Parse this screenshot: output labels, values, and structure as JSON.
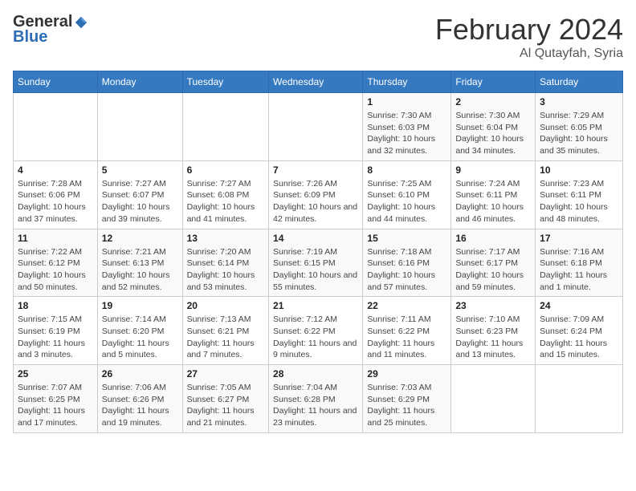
{
  "logo": {
    "general": "General",
    "blue": "Blue"
  },
  "title": "February 2024",
  "location": "Al Qutayfah, Syria",
  "days_of_week": [
    "Sunday",
    "Monday",
    "Tuesday",
    "Wednesday",
    "Thursday",
    "Friday",
    "Saturday"
  ],
  "weeks": [
    [
      {
        "day": "",
        "info": ""
      },
      {
        "day": "",
        "info": ""
      },
      {
        "day": "",
        "info": ""
      },
      {
        "day": "",
        "info": ""
      },
      {
        "day": "1",
        "sunrise": "Sunrise: 7:30 AM",
        "sunset": "Sunset: 6:03 PM",
        "daylight": "Daylight: 10 hours and 32 minutes."
      },
      {
        "day": "2",
        "sunrise": "Sunrise: 7:30 AM",
        "sunset": "Sunset: 6:04 PM",
        "daylight": "Daylight: 10 hours and 34 minutes."
      },
      {
        "day": "3",
        "sunrise": "Sunrise: 7:29 AM",
        "sunset": "Sunset: 6:05 PM",
        "daylight": "Daylight: 10 hours and 35 minutes."
      }
    ],
    [
      {
        "day": "4",
        "sunrise": "Sunrise: 7:28 AM",
        "sunset": "Sunset: 6:06 PM",
        "daylight": "Daylight: 10 hours and 37 minutes."
      },
      {
        "day": "5",
        "sunrise": "Sunrise: 7:27 AM",
        "sunset": "Sunset: 6:07 PM",
        "daylight": "Daylight: 10 hours and 39 minutes."
      },
      {
        "day": "6",
        "sunrise": "Sunrise: 7:27 AM",
        "sunset": "Sunset: 6:08 PM",
        "daylight": "Daylight: 10 hours and 41 minutes."
      },
      {
        "day": "7",
        "sunrise": "Sunrise: 7:26 AM",
        "sunset": "Sunset: 6:09 PM",
        "daylight": "Daylight: 10 hours and 42 minutes."
      },
      {
        "day": "8",
        "sunrise": "Sunrise: 7:25 AM",
        "sunset": "Sunset: 6:10 PM",
        "daylight": "Daylight: 10 hours and 44 minutes."
      },
      {
        "day": "9",
        "sunrise": "Sunrise: 7:24 AM",
        "sunset": "Sunset: 6:11 PM",
        "daylight": "Daylight: 10 hours and 46 minutes."
      },
      {
        "day": "10",
        "sunrise": "Sunrise: 7:23 AM",
        "sunset": "Sunset: 6:11 PM",
        "daylight": "Daylight: 10 hours and 48 minutes."
      }
    ],
    [
      {
        "day": "11",
        "sunrise": "Sunrise: 7:22 AM",
        "sunset": "Sunset: 6:12 PM",
        "daylight": "Daylight: 10 hours and 50 minutes."
      },
      {
        "day": "12",
        "sunrise": "Sunrise: 7:21 AM",
        "sunset": "Sunset: 6:13 PM",
        "daylight": "Daylight: 10 hours and 52 minutes."
      },
      {
        "day": "13",
        "sunrise": "Sunrise: 7:20 AM",
        "sunset": "Sunset: 6:14 PM",
        "daylight": "Daylight: 10 hours and 53 minutes."
      },
      {
        "day": "14",
        "sunrise": "Sunrise: 7:19 AM",
        "sunset": "Sunset: 6:15 PM",
        "daylight": "Daylight: 10 hours and 55 minutes."
      },
      {
        "day": "15",
        "sunrise": "Sunrise: 7:18 AM",
        "sunset": "Sunset: 6:16 PM",
        "daylight": "Daylight: 10 hours and 57 minutes."
      },
      {
        "day": "16",
        "sunrise": "Sunrise: 7:17 AM",
        "sunset": "Sunset: 6:17 PM",
        "daylight": "Daylight: 10 hours and 59 minutes."
      },
      {
        "day": "17",
        "sunrise": "Sunrise: 7:16 AM",
        "sunset": "Sunset: 6:18 PM",
        "daylight": "Daylight: 11 hours and 1 minute."
      }
    ],
    [
      {
        "day": "18",
        "sunrise": "Sunrise: 7:15 AM",
        "sunset": "Sunset: 6:19 PM",
        "daylight": "Daylight: 11 hours and 3 minutes."
      },
      {
        "day": "19",
        "sunrise": "Sunrise: 7:14 AM",
        "sunset": "Sunset: 6:20 PM",
        "daylight": "Daylight: 11 hours and 5 minutes."
      },
      {
        "day": "20",
        "sunrise": "Sunrise: 7:13 AM",
        "sunset": "Sunset: 6:21 PM",
        "daylight": "Daylight: 11 hours and 7 minutes."
      },
      {
        "day": "21",
        "sunrise": "Sunrise: 7:12 AM",
        "sunset": "Sunset: 6:22 PM",
        "daylight": "Daylight: 11 hours and 9 minutes."
      },
      {
        "day": "22",
        "sunrise": "Sunrise: 7:11 AM",
        "sunset": "Sunset: 6:22 PM",
        "daylight": "Daylight: 11 hours and 11 minutes."
      },
      {
        "day": "23",
        "sunrise": "Sunrise: 7:10 AM",
        "sunset": "Sunset: 6:23 PM",
        "daylight": "Daylight: 11 hours and 13 minutes."
      },
      {
        "day": "24",
        "sunrise": "Sunrise: 7:09 AM",
        "sunset": "Sunset: 6:24 PM",
        "daylight": "Daylight: 11 hours and 15 minutes."
      }
    ],
    [
      {
        "day": "25",
        "sunrise": "Sunrise: 7:07 AM",
        "sunset": "Sunset: 6:25 PM",
        "daylight": "Daylight: 11 hours and 17 minutes."
      },
      {
        "day": "26",
        "sunrise": "Sunrise: 7:06 AM",
        "sunset": "Sunset: 6:26 PM",
        "daylight": "Daylight: 11 hours and 19 minutes."
      },
      {
        "day": "27",
        "sunrise": "Sunrise: 7:05 AM",
        "sunset": "Sunset: 6:27 PM",
        "daylight": "Daylight: 11 hours and 21 minutes."
      },
      {
        "day": "28",
        "sunrise": "Sunrise: 7:04 AM",
        "sunset": "Sunset: 6:28 PM",
        "daylight": "Daylight: 11 hours and 23 minutes."
      },
      {
        "day": "29",
        "sunrise": "Sunrise: 7:03 AM",
        "sunset": "Sunset: 6:29 PM",
        "daylight": "Daylight: 11 hours and 25 minutes."
      },
      {
        "day": "",
        "info": ""
      },
      {
        "day": "",
        "info": ""
      }
    ]
  ]
}
